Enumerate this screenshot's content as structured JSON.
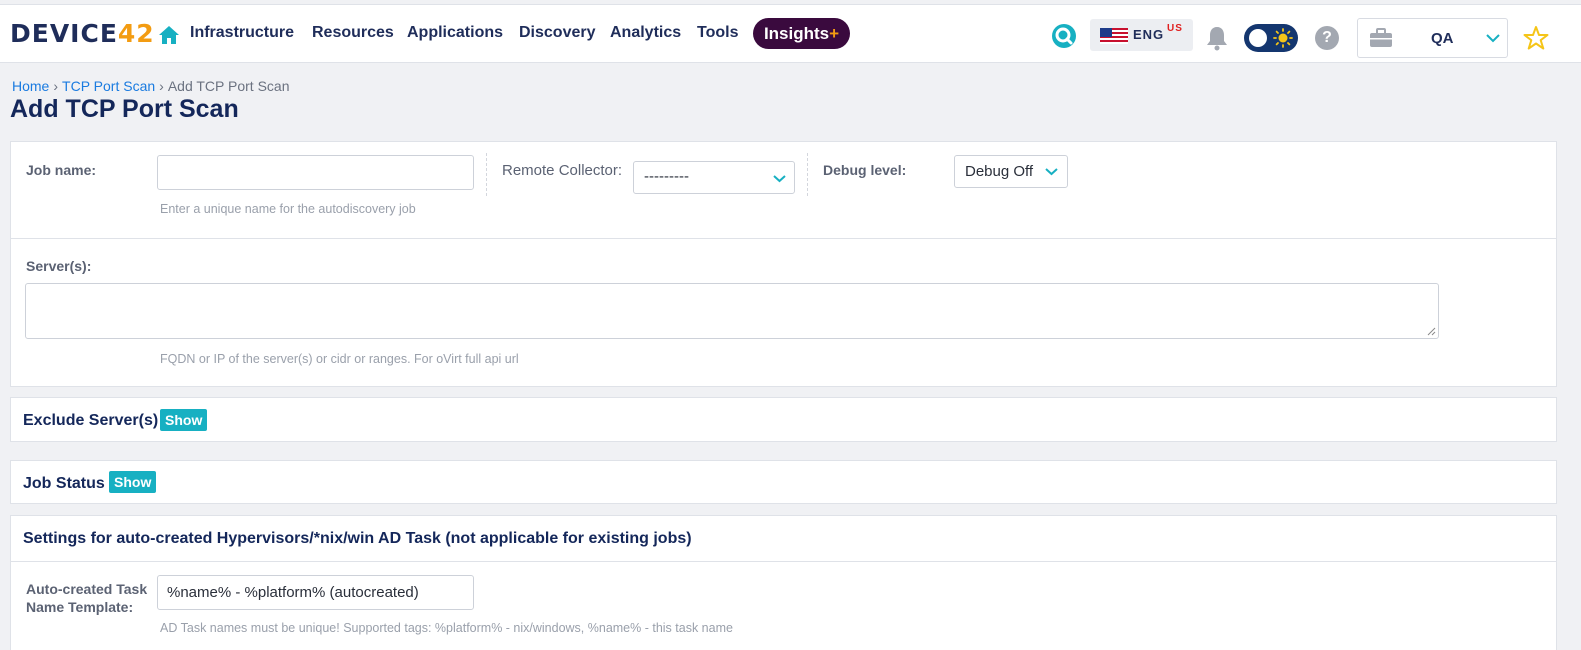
{
  "header": {
    "logo_text": "DEVICE",
    "logo_num": "42",
    "nav": [
      "Infrastructure",
      "Resources",
      "Applications",
      "Discovery",
      "Analytics",
      "Tools"
    ],
    "insights_label": "Insights",
    "insights_plus": "+",
    "lang": "ENG",
    "region": "US",
    "help_glyph": "?",
    "workspace": "QA",
    "icons": [
      "home-icon",
      "search-icon",
      "flag-icon",
      "bell-icon",
      "theme-toggle",
      "help-icon",
      "briefcase-icon",
      "chevron-down-icon",
      "star-icon"
    ],
    "colors": {
      "accent": "#17b0c2",
      "brand": "#1f2d5a",
      "insights_bg": "#3a0a3e",
      "logo_num": "#f39c12"
    }
  },
  "breadcrumb": {
    "home": "Home",
    "parent": "TCP Port Scan",
    "current": "Add TCP Port Scan",
    "sep": "›"
  },
  "page": {
    "title": "Add TCP Port Scan"
  },
  "form": {
    "job_name_label": "Job name:",
    "job_name_value": "",
    "job_name_help": "Enter a unique name for the autodiscovery job",
    "remote_collector_label": "Remote Collector:",
    "remote_collector_value": "---------",
    "debug_label": "Debug level:",
    "debug_value": "Debug Off",
    "servers_label": "Server(s):",
    "servers_value": "",
    "servers_help": "FQDN or IP of the server(s) or cidr or ranges. For oVirt full api url"
  },
  "sections": {
    "exclude_title": "Exclude Server(s)",
    "exclude_btn": "Show",
    "status_title": "Job Status",
    "status_btn": "Show",
    "settings_title": "Settings for auto-created Hypervisors/*nix/win AD Task (not applicable for existing jobs)",
    "template_label_1": "Auto-created Task",
    "template_label_2": "Name Template:",
    "template_value": "%name% - %platform% (autocreated)",
    "template_help": "AD Task names must be unique! Supported tags: %platform% - nix/windows, %name% - this task name"
  }
}
